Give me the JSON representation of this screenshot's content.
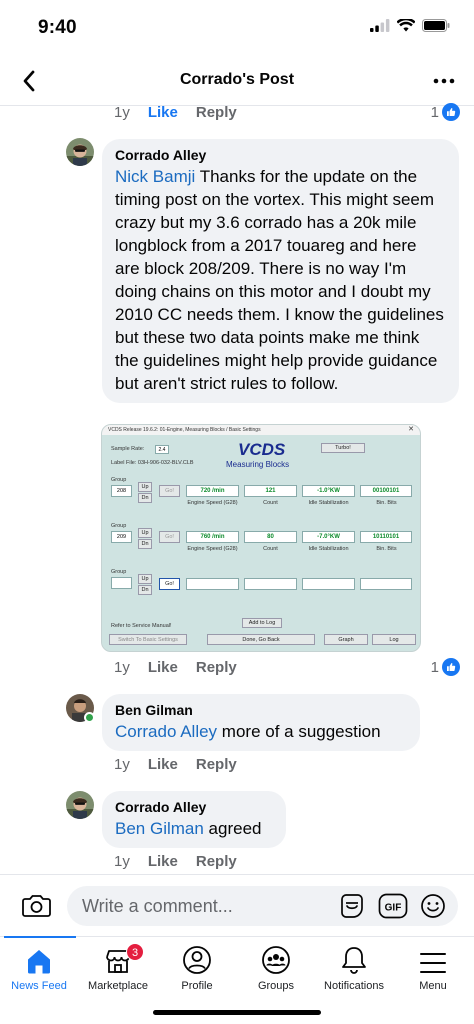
{
  "status_bar": {
    "time": "9:40"
  },
  "header": {
    "title": "Corrado's Post"
  },
  "top_actions": {
    "age": "1y",
    "like": "Like",
    "reply": "Reply",
    "reaction_count": "1"
  },
  "comments": [
    {
      "author": "Corrado Alley",
      "mention": "Nick Bamji",
      "text": " Thanks for the update on the timing post on the vortex. This might seem crazy but my 3.6 corrado has a 20k mile longblock from a 2017 touareg and here are block 208/209. There is no way I'm doing chains on this motor and I doubt my 2010 CC needs them. I know the guidelines but these two data points make me think the guidelines might help provide guidance but aren't strict rules to follow.",
      "age": "1y",
      "like": "Like",
      "reply": "Reply",
      "reaction_count": "1"
    },
    {
      "author": "Ben Gilman",
      "mention": "Corrado Alley",
      "text": " more of a suggestion",
      "age": "1y",
      "like": "Like",
      "reply": "Reply"
    },
    {
      "author": "Corrado Alley",
      "mention": "Ben Gilman",
      "text": " agreed",
      "age": "1y",
      "like": "Like",
      "reply": "Reply"
    }
  ],
  "vcds": {
    "window_title": "VCDS Release 19.6.2: 01-Engine, Measuring Blocks / Basic Settings",
    "logo": "VCDS",
    "subtitle": "Measuring Blocks",
    "sample_rate_label": "Sample Rate:",
    "sample_rate": "2.4",
    "label_file": "Label File: 03H-906-032-BLV.CLB",
    "turbo": "Turbo!",
    "group_label": "Group",
    "up": "Up",
    "dn": "Dn",
    "go": "Go!",
    "groups": [
      {
        "number": "208",
        "values": [
          "720 /min",
          "121",
          "-1.0°KW",
          "00100101"
        ],
        "labels": [
          "Engine Speed (G28)",
          "Count",
          "Idle Stabilization",
          "Bin. Bits"
        ]
      },
      {
        "number": "209",
        "values": [
          "760 /min",
          "80",
          "-7.0°KW",
          "10110101"
        ],
        "labels": [
          "Engine Speed (G28)",
          "Count",
          "Idle Stabilization",
          "Bin. Bits"
        ]
      }
    ],
    "refer": "Refer to Service Manual!",
    "add_to_log": "Add to Log",
    "switch_basic": "Switch To Basic Settings",
    "done": "Done, Go Back",
    "graph": "Graph",
    "log": "Log"
  },
  "composer": {
    "placeholder": "Write a comment..."
  },
  "tabs": [
    {
      "label": "News Feed",
      "icon": "home-icon",
      "active": true
    },
    {
      "label": "Marketplace",
      "icon": "marketplace-icon",
      "badge": "3"
    },
    {
      "label": "Profile",
      "icon": "profile-icon"
    },
    {
      "label": "Groups",
      "icon": "groups-icon"
    },
    {
      "label": "Notifications",
      "icon": "bell-icon"
    },
    {
      "label": "Menu",
      "icon": "menu-icon"
    }
  ],
  "colors": {
    "accent": "#1877f2",
    "mention": "#1b6bc0",
    "bubble": "#f0f2f5",
    "muted": "#65676b",
    "badge": "#e41e3f",
    "online": "#31a24c"
  }
}
